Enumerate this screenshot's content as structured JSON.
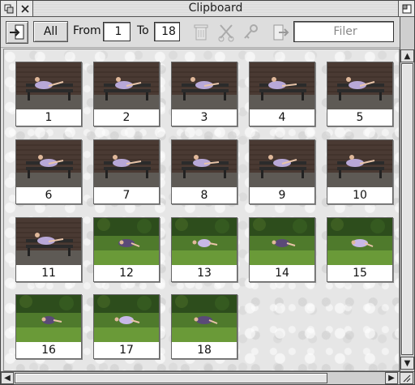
{
  "window": {
    "title": "Clipboard"
  },
  "toolbar": {
    "all_label": "All",
    "from_label": "From",
    "from_value": "1",
    "to_label": "To",
    "to_value": "18",
    "filer_placeholder": "Filer"
  },
  "thumbnails": [
    {
      "label": "1",
      "scene": "brick"
    },
    {
      "label": "2",
      "scene": "brick"
    },
    {
      "label": "3",
      "scene": "brick"
    },
    {
      "label": "4",
      "scene": "brick"
    },
    {
      "label": "5",
      "scene": "brick"
    },
    {
      "label": "6",
      "scene": "brick"
    },
    {
      "label": "7",
      "scene": "brick"
    },
    {
      "label": "8",
      "scene": "brick"
    },
    {
      "label": "9",
      "scene": "brick"
    },
    {
      "label": "10",
      "scene": "brick"
    },
    {
      "label": "11",
      "scene": "brick"
    },
    {
      "label": "12",
      "scene": "grass"
    },
    {
      "label": "13",
      "scene": "grass"
    },
    {
      "label": "14",
      "scene": "grass"
    },
    {
      "label": "15",
      "scene": "grass"
    },
    {
      "label": "16",
      "scene": "grass"
    },
    {
      "label": "17",
      "scene": "grass"
    },
    {
      "label": "18",
      "scene": "grass"
    }
  ]
}
